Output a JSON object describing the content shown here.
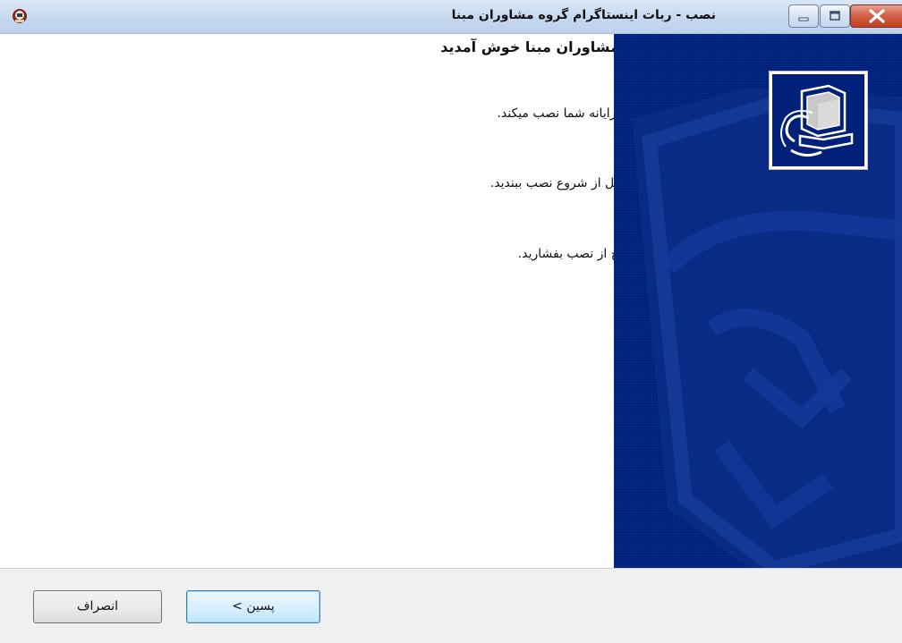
{
  "window": {
    "title": "نصب - ربات اینستاگرام گروه مشاوران مبنا"
  },
  "wizard": {
    "heading": "به جادوگر نصب ربات اینستاگرام گروه مشاوران مبنا خوش آمدید",
    "paragraphs": [
      "این برنامه ربات اینستاگرام گروه مشاوران مبنا را در رایانه شما نصب میکند.",
      "پیشنهاد می‌شود که تمام برنامه‌هایی که باز است را قبل از شروع نصب ببندید.",
      "براي ادامه پسين را بفشاريد، يا انصراف را براي خروج از نصب بفشاريد."
    ]
  },
  "buttons": {
    "next_label": "پسین >",
    "cancel_label": "انصراف"
  },
  "icons": {
    "app": "installer-app-icon",
    "close": "close-icon",
    "maximize": "maximize-icon",
    "minimize": "minimize-icon",
    "logo": "computer-install-icon"
  },
  "colors": {
    "side_panel": "#00207a",
    "next_border": "#3c7fb1",
    "close_button": "#c1411f"
  }
}
